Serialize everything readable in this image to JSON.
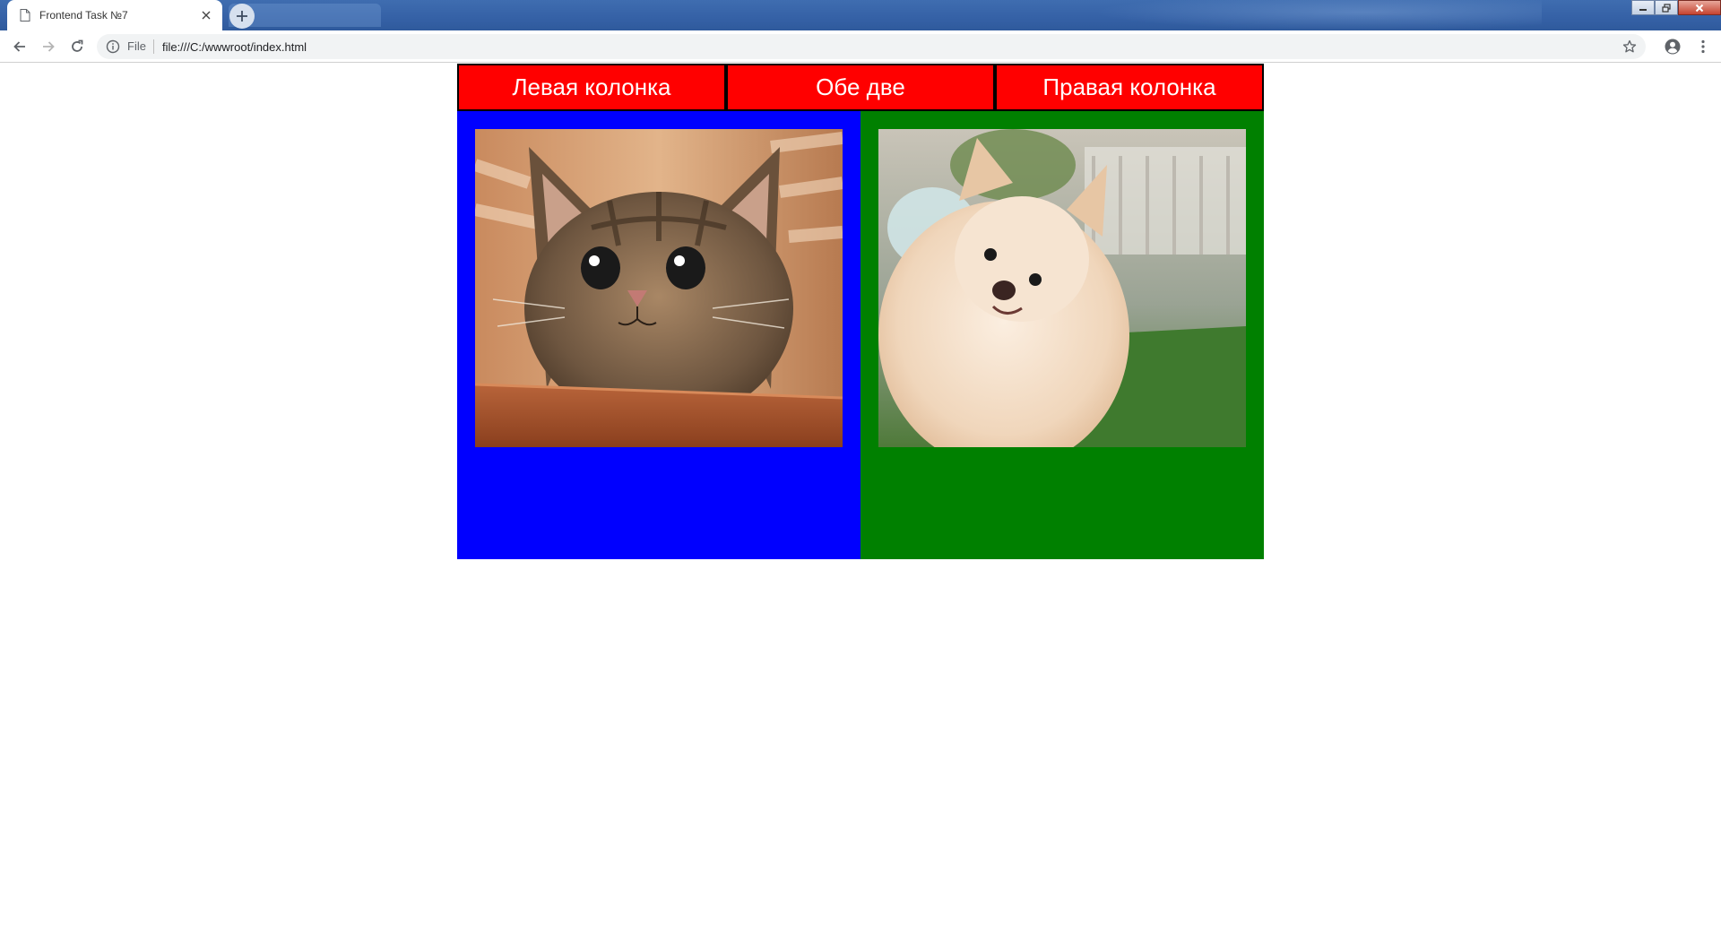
{
  "browser": {
    "tab_title": "Frontend Task №7",
    "scheme_label": "File",
    "url": "file:///C:/wwwroot/index.html"
  },
  "page": {
    "headers": [
      "Левая колонка",
      "Обе две",
      "Правая колонка"
    ],
    "colors": {
      "header_bg": "#ff0000",
      "header_border": "#000000",
      "header_text": "#ffffff",
      "left_column_bg": "#0000ff",
      "right_column_bg": "#008000"
    },
    "images": {
      "left": "cat-photo",
      "right": "pomeranian-dog-photo"
    }
  },
  "icons": [
    "page-icon",
    "close-icon",
    "plus-icon",
    "back-arrow-icon",
    "forward-arrow-icon",
    "reload-icon",
    "info-icon",
    "star-icon",
    "profile-icon",
    "kebab-menu-icon",
    "minimize-icon",
    "maximize-icon",
    "window-close-icon"
  ]
}
